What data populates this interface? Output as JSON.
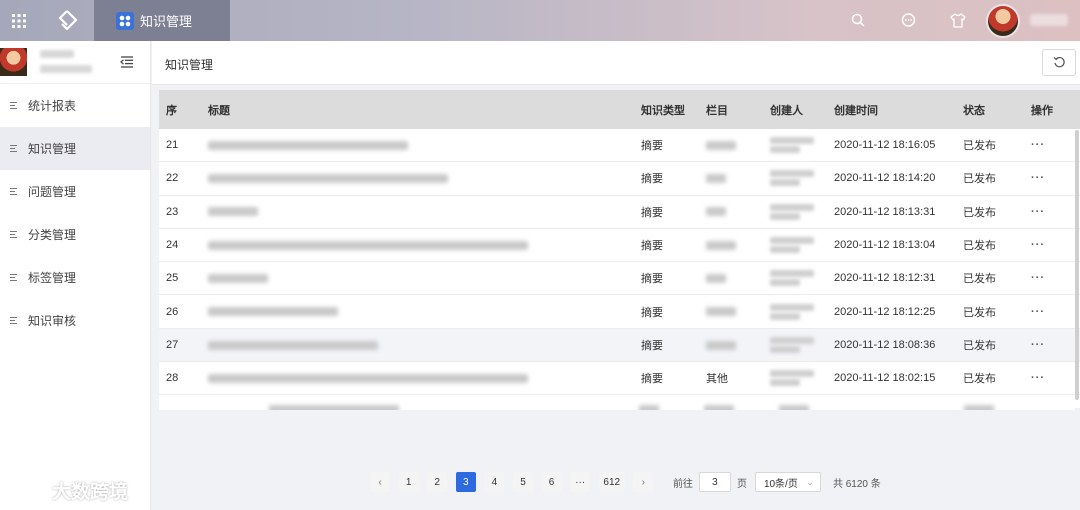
{
  "topbar": {
    "tab_label": "知识管理",
    "icons": [
      "apps-grid-icon",
      "app-logo-icon",
      "search-icon",
      "message-icon",
      "tshirt-icon"
    ]
  },
  "sidebar": {
    "items": [
      {
        "label": "统计报表"
      },
      {
        "label": "知识管理"
      },
      {
        "label": "问题管理"
      },
      {
        "label": "分类管理"
      },
      {
        "label": "标签管理"
      },
      {
        "label": "知识审核"
      }
    ]
  },
  "main": {
    "title": "知识管理"
  },
  "table": {
    "headers": {
      "seq": "序",
      "title": "标题",
      "type": "知识类型",
      "column": "栏目",
      "creator": "创建人",
      "time": "创建时间",
      "status": "状态",
      "op": "操作"
    },
    "rows": [
      {
        "seq": "21",
        "type": "摘要",
        "column": "",
        "time": "2020-11-12 18:16:05",
        "status": "已发布",
        "op": "···"
      },
      {
        "seq": "22",
        "type": "摘要",
        "column": "",
        "time": "2020-11-12 18:14:20",
        "status": "已发布",
        "op": "···"
      },
      {
        "seq": "23",
        "type": "摘要",
        "column": "",
        "time": "2020-11-12 18:13:31",
        "status": "已发布",
        "op": "···"
      },
      {
        "seq": "24",
        "type": "摘要",
        "column": "",
        "time": "2020-11-12 18:13:04",
        "status": "已发布",
        "op": "···"
      },
      {
        "seq": "25",
        "type": "摘要",
        "column": "",
        "time": "2020-11-12 18:12:31",
        "status": "已发布",
        "op": "···"
      },
      {
        "seq": "26",
        "type": "摘要",
        "column": "",
        "time": "2020-11-12 18:12:25",
        "status": "已发布",
        "op": "···"
      },
      {
        "seq": "27",
        "type": "摘要",
        "column": "",
        "time": "2020-11-12 18:08:36",
        "status": "已发布",
        "op": "···"
      },
      {
        "seq": "28",
        "type": "摘要",
        "column": "其他",
        "time": "2020-11-12 18:02:15",
        "status": "已发布",
        "op": "···"
      }
    ]
  },
  "pagination": {
    "pages": [
      "1",
      "2",
      "3",
      "4",
      "5",
      "6",
      "···",
      "612"
    ],
    "current": "3",
    "prev": "‹",
    "next": "›",
    "goto_prefix": "前往",
    "goto_value": "3",
    "goto_suffix": "页",
    "page_size": "10条/页",
    "total": "共 6120 条"
  },
  "watermark": "大数跨境",
  "colors": {
    "accent": "#2d6ae0",
    "tab_bg": "#7d7f93",
    "header_row_bg": "#dcdcdc",
    "active_menu_bg": "#ebebf2"
  }
}
